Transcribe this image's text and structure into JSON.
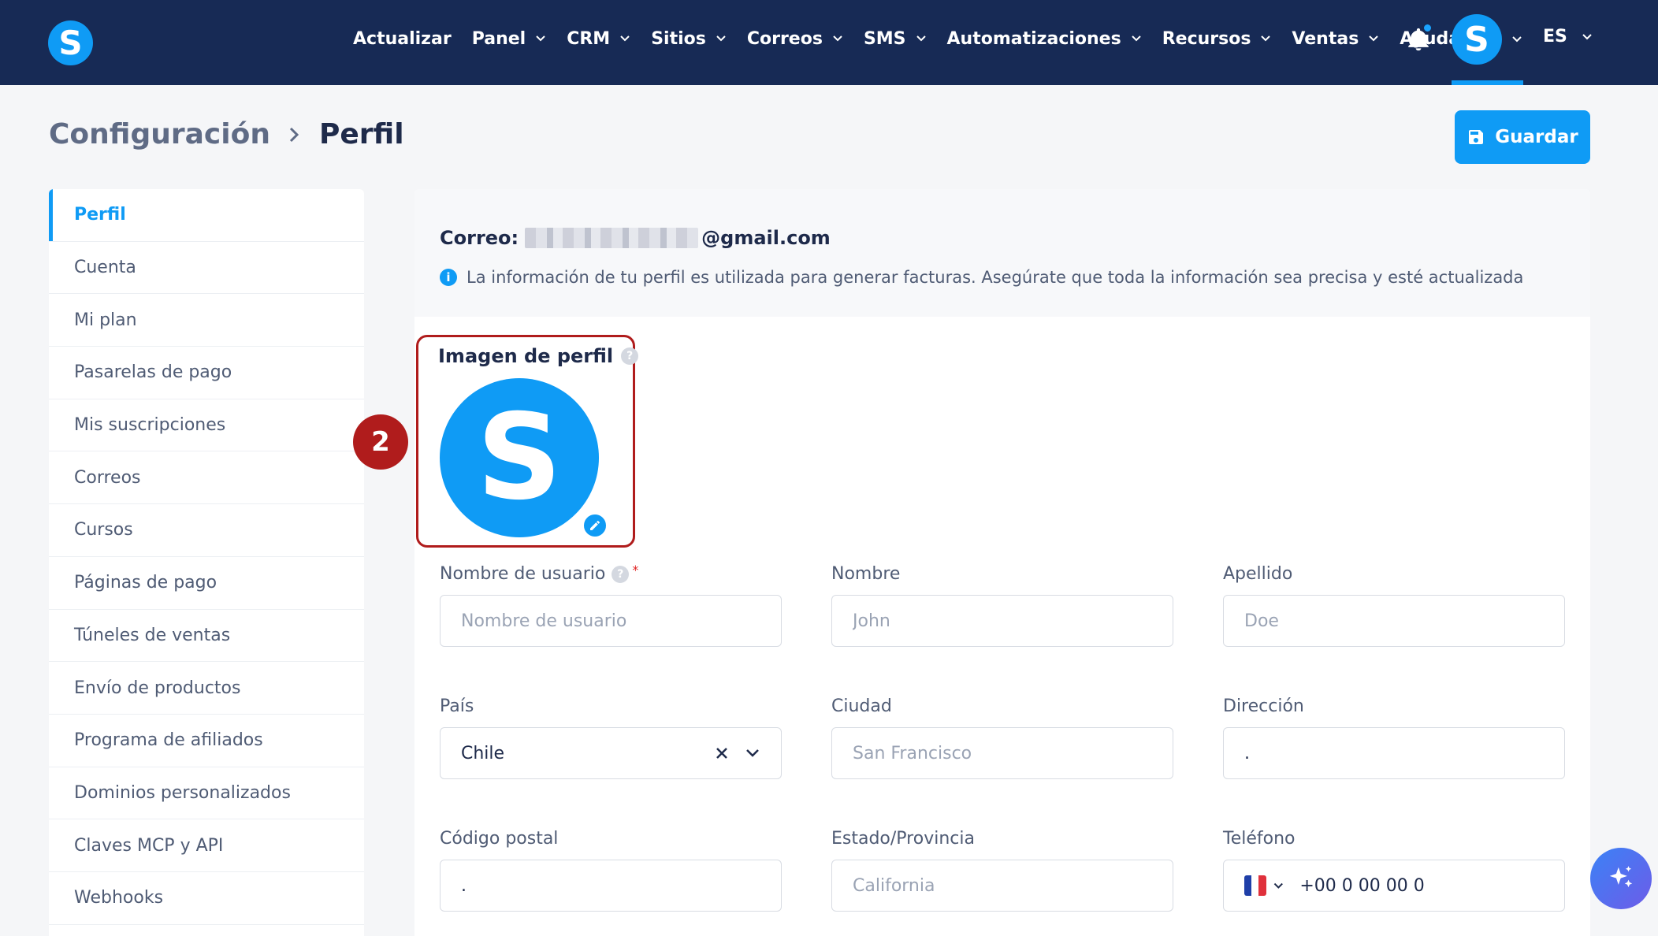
{
  "nav": {
    "logo_letter": "S",
    "items": [
      {
        "label": "Actualizar",
        "has_menu": false
      },
      {
        "label": "Panel",
        "has_menu": true
      },
      {
        "label": "CRM",
        "has_menu": true
      },
      {
        "label": "Sitios",
        "has_menu": true
      },
      {
        "label": "Correos",
        "has_menu": true
      },
      {
        "label": "SMS",
        "has_menu": true
      },
      {
        "label": "Automatizaciones",
        "has_menu": true
      },
      {
        "label": "Recursos",
        "has_menu": true
      },
      {
        "label": "Ventas",
        "has_menu": true
      },
      {
        "label": "Ayuda",
        "has_menu": false
      }
    ],
    "bell_icon": "bell-icon",
    "avatar_letter": "S",
    "language": "ES"
  },
  "header": {
    "breadcrumb_parent": "Configuración",
    "breadcrumb_current": "Perfil",
    "save_label": "Guardar"
  },
  "sidebar": {
    "items": [
      {
        "label": "Perfil",
        "active": true
      },
      {
        "label": "Cuenta"
      },
      {
        "label": "Mi plan"
      },
      {
        "label": "Pasarelas de pago"
      },
      {
        "label": "Mis suscripciones"
      },
      {
        "label": "Correos"
      },
      {
        "label": "Cursos"
      },
      {
        "label": "Páginas de pago"
      },
      {
        "label": "Túneles de ventas"
      },
      {
        "label": "Envío de productos"
      },
      {
        "label": "Programa de afiliados"
      },
      {
        "label": "Dominios personalizados"
      },
      {
        "label": "Claves MCP y API"
      },
      {
        "label": "Webhooks"
      }
    ]
  },
  "profile": {
    "email_label": "Correo:",
    "email_domain": "@gmail.com",
    "info_text": "La información de tu perfil es utilizada para generar facturas. Asegúrate que toda la información sea precisa y esté actualizada",
    "image_label": "Imagen de perfil",
    "avatar_letter": "S",
    "step_badge": "2"
  },
  "form": {
    "username": {
      "label": "Nombre de usuario",
      "placeholder": "Nombre de usuario",
      "value": ""
    },
    "first_name": {
      "label": "Nombre",
      "placeholder": "John",
      "value": ""
    },
    "last_name": {
      "label": "Apellido",
      "placeholder": "Doe",
      "value": ""
    },
    "country": {
      "label": "País",
      "value": "Chile"
    },
    "city": {
      "label": "Ciudad",
      "placeholder": "San Francisco",
      "value": ""
    },
    "address": {
      "label": "Dirección",
      "placeholder": "",
      "value": "."
    },
    "postal_code": {
      "label": "Código postal",
      "placeholder": "",
      "value": "."
    },
    "state": {
      "label": "Estado/Provincia",
      "placeholder": "California",
      "value": ""
    },
    "phone": {
      "label": "Teléfono",
      "value": "+00 0 00 00 0"
    }
  },
  "colors": {
    "navbar": "#172a55",
    "accent": "#0f9bf5",
    "highlight": "#b01c1c"
  }
}
